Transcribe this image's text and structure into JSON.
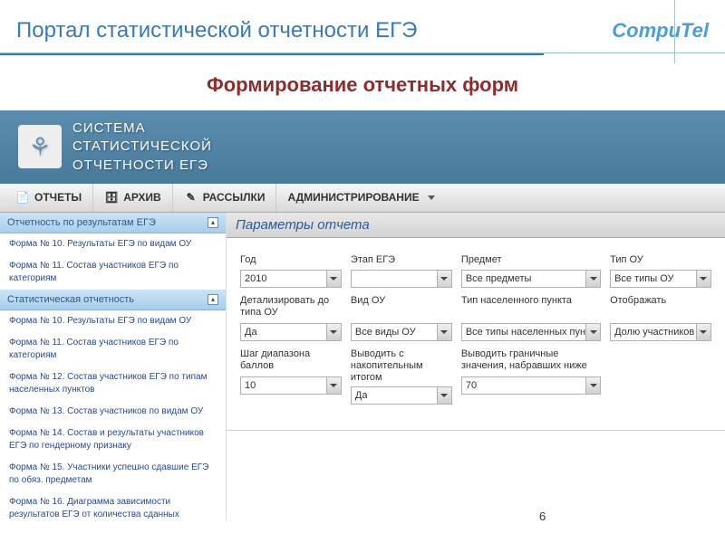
{
  "top": {
    "title": "Портал статистической отчетности ЕГЭ",
    "brand_left": "Compu",
    "brand_right": "Tel"
  },
  "section_title": "Формирование отчетных форм",
  "app_title": "СИСТЕМА\nСТАТИСТИЧЕСКОЙ\nОТЧЕТНОСТИ ЕГЭ",
  "menu": {
    "reports": "ОТЧЕТЫ",
    "archive": "АРХИВ",
    "mailing": "РАССЫЛКИ",
    "admin": "АДМИНИСТРИРОВАНИЕ"
  },
  "sidebar": {
    "groups": [
      {
        "title": "Отчетность по результатам ЕГЭ",
        "items": [
          "Форма № 10. Результаты ЕГЭ по видам ОУ",
          "Форма № 11. Состав участников ЕГЭ по категориям"
        ]
      },
      {
        "title": "Статистическая отчетность",
        "items": [
          "Форма № 10. Результаты ЕГЭ по видам ОУ",
          "Форма № 11. Состав участников ЕГЭ по категориям",
          "Форма № 12. Состав участников ЕГЭ по типам населенных пунктов",
          "Форма № 13. Состав участников по видам ОУ",
          "Форма № 14. Состав и результаты участников ЕГЭ по гендерному признаку",
          "Форма № 15. Участники успешно сдавшие ЕГЭ по обяз. предметам",
          "Форма № 16. Диаграмма зависимости результатов ЕГЭ от количества сданных"
        ]
      }
    ]
  },
  "panel_title": "Параметры отчета",
  "form": [
    {
      "label": "Год",
      "value": "2010"
    },
    {
      "label": "Этап ЕГЭ",
      "value": ""
    },
    {
      "label": "Предмет",
      "value": "Все предметы"
    },
    {
      "label": "Тип ОУ",
      "value": "Все типы ОУ"
    },
    {
      "label": "Детализировать до типа ОУ",
      "value": "Да",
      "tall": true
    },
    {
      "label": "Вид ОУ",
      "value": "Все виды ОУ",
      "tall": true
    },
    {
      "label": "Тип населенного пункта",
      "value": "Все типы населенных пун",
      "tall": true
    },
    {
      "label": "Отображать",
      "value": "Долю участников",
      "tall": true
    },
    {
      "label": "Шаг диапазона баллов",
      "value": "10",
      "tall": true
    },
    {
      "label": "Выводить с накопительным итогом",
      "value": "Да",
      "tall": true
    },
    {
      "label": "Выводить граничные значения, набравших ниже",
      "value": "70",
      "tall": true
    },
    {
      "label": "",
      "value": "",
      "empty": true,
      "tall": true
    }
  ],
  "page_number": "6"
}
